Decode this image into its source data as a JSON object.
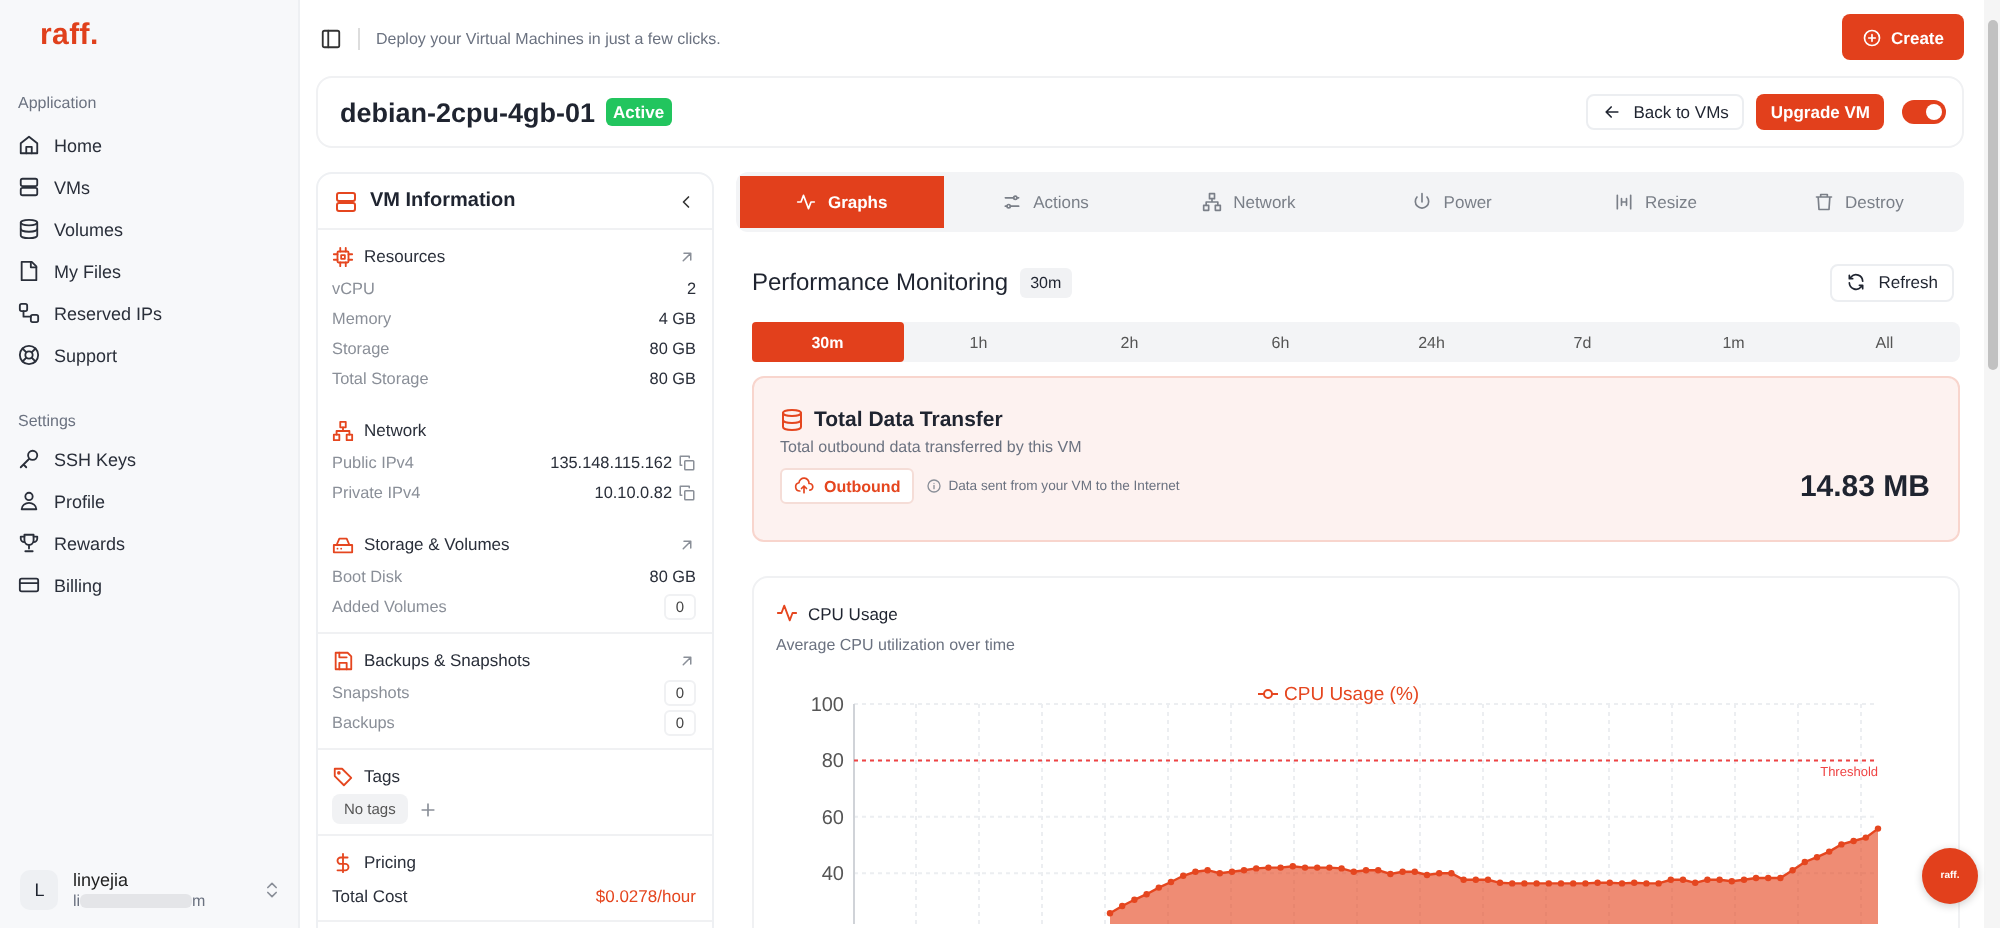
{
  "sidebar": {
    "logo": "raff.",
    "sections": [
      {
        "heading": "Application",
        "items": [
          {
            "label": "Home",
            "selected": false
          },
          {
            "label": "VMs",
            "selected": false
          },
          {
            "label": "Volumes",
            "selected": false
          },
          {
            "label": "My Files",
            "selected": false
          },
          {
            "label": "Reserved IPs",
            "selected": false
          },
          {
            "label": "Support",
            "selected": false
          }
        ]
      },
      {
        "heading": "Settings",
        "items": [
          {
            "label": "SSH Keys",
            "selected": false
          },
          {
            "label": "Profile",
            "selected": false
          },
          {
            "label": "Rewards",
            "selected": false
          },
          {
            "label": "Billing",
            "selected": false
          }
        ]
      }
    ]
  },
  "user": {
    "avatar": "L",
    "name": "linyejia",
    "email_start": "li",
    "email_end": "m"
  },
  "header": {
    "tagline": "Deploy your Virtual Machines in just a few clicks.",
    "create_button": "Create"
  },
  "vm": {
    "name": "debian-2cpu-4gb-01",
    "status": "Active",
    "back_button": "Back to VMs",
    "upgrade_button": "Upgrade VM",
    "power_toggle": {
      "on": true
    }
  },
  "info_panel": {
    "title": "VM Information",
    "sections": [
      {
        "kind": "rows",
        "title": "Resources",
        "has_link": true,
        "rows": [
          {
            "kind": "plain",
            "label": "vCPU",
            "value": "2"
          },
          {
            "kind": "plain",
            "label": "Memory",
            "value": "4 GB"
          },
          {
            "kind": "plain",
            "label": "Storage",
            "value": "80 GB"
          },
          {
            "kind": "plain",
            "label": "Total Storage",
            "value": "80 GB"
          }
        ]
      },
      {
        "kind": "rows",
        "title": "Network",
        "has_link": false,
        "rows": [
          {
            "kind": "copy",
            "label": "Public IPv4",
            "value": "135.148.115.162"
          },
          {
            "kind": "copy",
            "label": "Private IPv4",
            "value": "10.10.0.82"
          }
        ]
      },
      {
        "kind": "rows",
        "title": "Storage & Volumes",
        "has_link": true,
        "rows": [
          {
            "kind": "plain",
            "label": "Boot Disk",
            "value": "80 GB"
          },
          {
            "kind": "count",
            "label": "Added Volumes",
            "value": "0"
          }
        ]
      },
      {
        "kind": "rows",
        "title": "Backups & Snapshots",
        "has_link": true,
        "rows": [
          {
            "kind": "count",
            "label": "Snapshots",
            "value": "0"
          },
          {
            "kind": "count",
            "label": "Backups",
            "value": "0"
          }
        ]
      },
      {
        "kind": "tags",
        "title": "Tags",
        "has_link": false,
        "chip": "No tags"
      },
      {
        "kind": "rows",
        "title": "Pricing",
        "has_link": false,
        "rows": [
          {
            "kind": "cost",
            "label": "Total Cost",
            "value": "$0.0278/hour"
          }
        ]
      }
    ]
  },
  "tabs": [
    {
      "label": "Graphs",
      "selected": true
    },
    {
      "label": "Actions",
      "selected": false
    },
    {
      "label": "Network",
      "selected": false
    },
    {
      "label": "Power",
      "selected": false
    },
    {
      "label": "Resize",
      "selected": false
    },
    {
      "label": "Destroy",
      "selected": false
    }
  ],
  "monitoring": {
    "title": "Performance Monitoring",
    "range_badge": "30m",
    "refresh_button": "Refresh",
    "ranges": [
      {
        "label": "30m",
        "selected": true
      },
      {
        "label": "1h",
        "selected": false
      },
      {
        "label": "2h",
        "selected": false
      },
      {
        "label": "6h",
        "selected": false
      },
      {
        "label": "24h",
        "selected": false
      },
      {
        "label": "7d",
        "selected": false
      },
      {
        "label": "1m",
        "selected": false
      },
      {
        "label": "All",
        "selected": false
      }
    ]
  },
  "transfer": {
    "title": "Total Data Transfer",
    "subtitle": "Total outbound data transferred by this VM",
    "direction": "Outbound",
    "note": "Data sent from your VM to the Internet",
    "total": "14.83 MB"
  },
  "cpu": {
    "title": "CPU Usage",
    "subtitle": "Average CPU utilization over time",
    "chart_data": {
      "type": "area",
      "ylim": [
        22,
        100
      ],
      "yticks": [
        40,
        60,
        80,
        100
      ],
      "series": [
        {
          "name": "CPU Usage (%)",
          "color": "#e5461f",
          "values": [
            null,
            null,
            null,
            null,
            null,
            null,
            null,
            null,
            null,
            null,
            null,
            null,
            null,
            null,
            null,
            null,
            null,
            null,
            null,
            null,
            null,
            25.8,
            28.4,
            30.6,
            32.6,
            34.9,
            36.9,
            39.1,
            40.5,
            41.1,
            40,
            40.5,
            41.1,
            41.7,
            42,
            42,
            42.5,
            42,
            42,
            42,
            41.7,
            40.5,
            41.1,
            41.1,
            39.7,
            40.5,
            40.5,
            39.4,
            40,
            40,
            37.7,
            37.7,
            37.7,
            36.6,
            36.4,
            36.4,
            36.4,
            36.4,
            36.4,
            36.4,
            36.4,
            36.6,
            36.6,
            36.4,
            36.6,
            36.4,
            36.4,
            37.7,
            37.7,
            36.6,
            37.7,
            37.7,
            37.2,
            37.7,
            38.3,
            38.3,
            38.3,
            41.1,
            44,
            45.7,
            47.7,
            50.2,
            51.4,
            52.6,
            55.8
          ]
        }
      ],
      "grid": true,
      "ref_lines": [
        {
          "axis": "y",
          "value": 80,
          "label": "Threshold"
        }
      ]
    }
  },
  "chat_button": {
    "label": "raff."
  }
}
